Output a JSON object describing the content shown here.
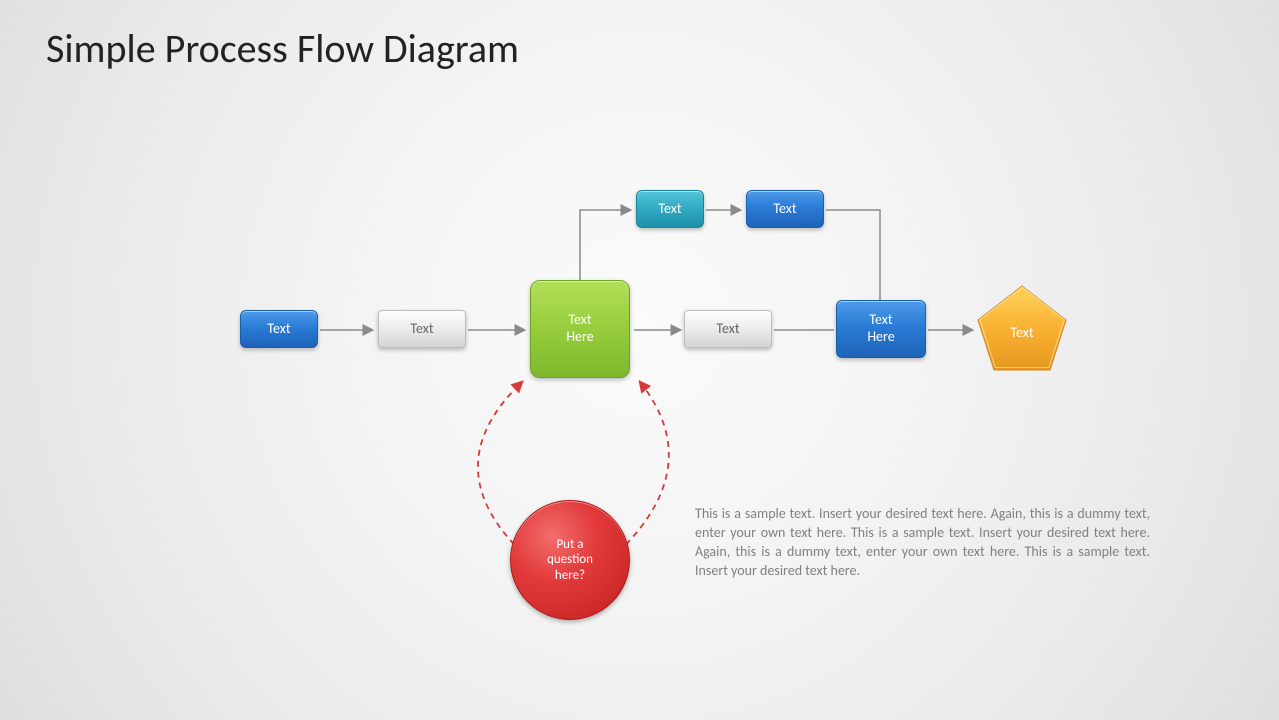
{
  "title": "Simple Process Flow Diagram",
  "nodes": {
    "n1": "Text",
    "n2": "Text",
    "n3": "Text\nHere",
    "n4": "Text",
    "n5": "Text\nHere",
    "n6": "Text",
    "top1": "Text",
    "top2": "Text",
    "circle": "Put a\nquestion\nhere?"
  },
  "body": "This is a sample text. Insert your desired text here. Again, this is a dummy text, enter your own text here. This is a sample text. Insert your desired text here. Again, this is a dummy text, enter your own text here. This is a sample text. Insert your desired text here."
}
